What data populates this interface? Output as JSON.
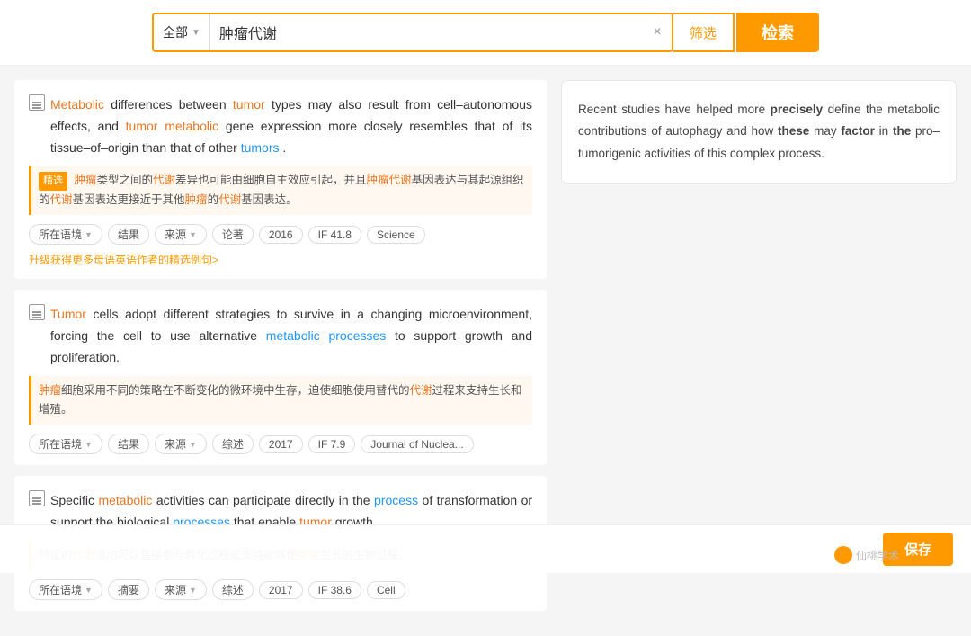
{
  "search": {
    "category_label": "全部",
    "query": "肿瘤代谢",
    "filter_label": "筛选",
    "submit_label": "检索",
    "clear_icon": "×"
  },
  "results": [
    {
      "id": "result-1",
      "text_en": {
        "parts": [
          {
            "text": "Metabolic",
            "type": "orange"
          },
          {
            "text": " differences between ",
            "type": "normal"
          },
          {
            "text": "tumor",
            "type": "orange"
          },
          {
            "text": " types may also result from cell–autonomous effects, and ",
            "type": "normal"
          },
          {
            "text": "tumor",
            "type": "orange"
          },
          {
            "text": " ",
            "type": "normal"
          },
          {
            "text": "metabolic",
            "type": "orange"
          },
          {
            "text": " gene expression more closely resembles that of its tissue–of–origin than that of other ",
            "type": "normal"
          },
          {
            "text": "tumors",
            "type": "blue"
          },
          {
            "text": ".",
            "type": "normal"
          }
        ]
      },
      "translation_label": "精选",
      "translation": "肿瘤类型之间的代谢差异也可能由细胞自主效应引起，并且肿瘤代谢基因表达与其起源组织的代谢基因表达更接近于其他肿瘤的代谢基因表达。",
      "translation_highlights": [
        {
          "word": "肿瘤",
          "type": "orange"
        },
        {
          "word": "代谢",
          "type": "orange"
        },
        {
          "word": "肿瘤代谢",
          "type": "orange"
        },
        {
          "word": "代谢",
          "type": "orange"
        },
        {
          "word": "肿瘤",
          "type": "orange"
        },
        {
          "word": "代谢",
          "type": "orange"
        }
      ],
      "tags": [
        "所在语境",
        "结果",
        "来源",
        "论著",
        "2016",
        "IF 41.8",
        "Science"
      ],
      "tags_dropdown": [
        "所在语境",
        "来源"
      ],
      "upgrade_link": "升级获得更多母语英语作者的精选例句>"
    },
    {
      "id": "result-2",
      "text_en": {
        "parts": [
          {
            "text": "Tumor",
            "type": "orange"
          },
          {
            "text": " cells adopt different strategies to survive in a changing microenvironment, forcing the cell to use alternative ",
            "type": "normal"
          },
          {
            "text": "metabolic processes",
            "type": "blue"
          },
          {
            "text": " to support growth and proliferation.",
            "type": "normal"
          }
        ]
      },
      "translation_label": null,
      "translation": "肿瘤细胞采用不同的策略在不断变化的微环境中生存，迫使细胞使用替代的代谢过程来支持生长和增殖。",
      "tags": [
        "所在语境",
        "结果",
        "来源",
        "综述",
        "2017",
        "IF 7.9",
        "Journal of Nuclea..."
      ],
      "tags_dropdown": [
        "所在语境",
        "来源"
      ]
    },
    {
      "id": "result-3",
      "text_en": {
        "parts": [
          {
            "text": "Specific ",
            "type": "normal"
          },
          {
            "text": "metabolic",
            "type": "orange"
          },
          {
            "text": " activities can participate directly in the ",
            "type": "normal"
          },
          {
            "text": "process",
            "type": "blue"
          },
          {
            "text": " of transformation or support the biological ",
            "type": "normal"
          },
          {
            "text": "processes",
            "type": "blue"
          },
          {
            "text": " that enable ",
            "type": "normal"
          },
          {
            "text": "tumor",
            "type": "orange"
          },
          {
            "text": " growth.",
            "type": "normal"
          }
        ]
      },
      "translation_label": null,
      "translation": "特定的代谢活动可以直接参与转化过程或支持能够使肿瘤生长的生物过程。",
      "tags": [
        "所在语境",
        "摘要",
        "来源",
        "综述",
        "2017",
        "IF 38.6",
        "Cell"
      ],
      "tags_dropdown": [
        "所在语境",
        "来源"
      ]
    }
  ],
  "context_card": {
    "text": "Recent studies have helped more precisely define the metabolic contributions of autophagy and how these may factor in the pro–tumorigenic activities of this complex process."
  },
  "watermark": {
    "label": "仙桃学术"
  },
  "bottom": {
    "save_label": "保存"
  }
}
